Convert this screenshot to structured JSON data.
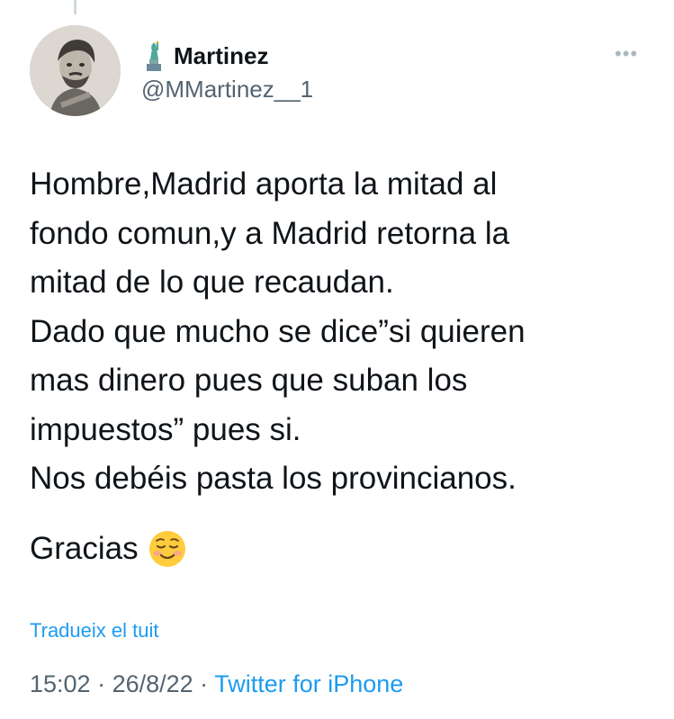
{
  "tweet": {
    "author": {
      "name": "Martinez",
      "handle": "@MMartinez__1"
    },
    "text_lines": [
      "Hombre,Madrid aporta la mitad al",
      "fondo comun,y a Madrid retorna la",
      "mitad de lo que recaudan.",
      "Dado que mucho se dice”si quieren",
      "mas dinero pues que suban los",
      "impuestos” pues si.",
      "Nos debéis pasta los provincianos."
    ],
    "closing": "Gracias",
    "translate_label": "Tradueix el tuit",
    "time": "15:02",
    "date": "26/8/22",
    "separator": " · ",
    "source": "Twitter for iPhone"
  },
  "icons": {
    "name_badge": "statue-of-liberty-icon",
    "more": "more-options-icon",
    "closing_emoji": "smiling-face-icon"
  },
  "colors": {
    "link": "#1d9bf0",
    "secondary_text": "#536471",
    "primary_text": "#0f1419"
  }
}
